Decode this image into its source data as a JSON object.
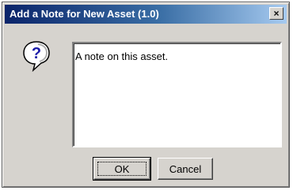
{
  "dialog": {
    "title": "Add a Note for New Asset (1.0)",
    "close_glyph": "×",
    "icon": "question-icon",
    "note_text": "A note on this asset.",
    "ok_label": "OK",
    "cancel_label": "Cancel"
  },
  "colors": {
    "titlebar_start": "#0a246a",
    "titlebar_end": "#a6caf0",
    "face": "#d6d3ce"
  }
}
